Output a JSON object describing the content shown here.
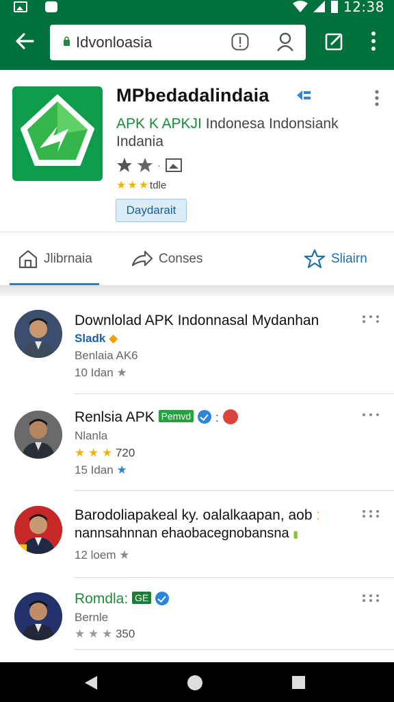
{
  "status_bar": {
    "time": "12:38"
  },
  "toolbar": {
    "url": "Idvonloasia"
  },
  "app": {
    "title": "MPbedadalindaia",
    "subtitle_accent": "APK K APKJI",
    "subtitle_rest": "Indonesa Indonsiank Indania",
    "small_rating_text": "tdle",
    "download_label": "Daydarait",
    "colors": {
      "brand": "#00703c",
      "icon_bg": "#0d9b4c",
      "accent_blue": "#2b7cc2"
    }
  },
  "tabs": [
    {
      "label": "Jlibrnaia",
      "icon": "home-icon"
    },
    {
      "label": "Conses",
      "icon": "share-icon"
    },
    {
      "label": "Sliairn",
      "icon": "star-icon"
    }
  ],
  "list": [
    {
      "title": "Downlolad APK Indonnasal Mydanhan",
      "line1": "Sladk",
      "line2": "Benlaia AK6",
      "line3": "10 Idan"
    },
    {
      "title": "Renlsia APK",
      "badge": "Pemvd",
      "line1": "Nlanla",
      "rating_text": "720",
      "line3": "15 Idan"
    },
    {
      "title": "Barodoliapakeal ky. oalalkaapan, aob",
      "title2": "nannsahnnan ehaobacegnobansna",
      "line3": "12 loem"
    },
    {
      "title": "Romdla:",
      "badge": "GE",
      "line1": "Bernle",
      "rating_text": "350"
    }
  ]
}
